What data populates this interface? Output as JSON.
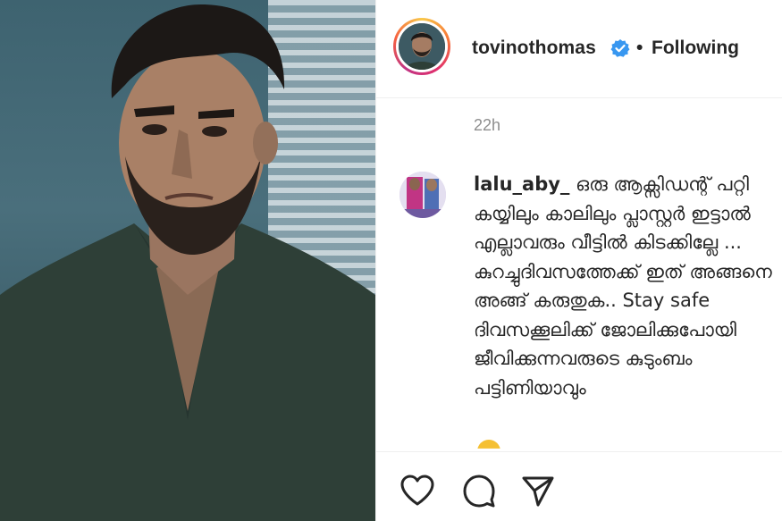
{
  "post": {
    "username": "tovinothomas",
    "separator": "•",
    "follow_status": "Following",
    "verified": true,
    "accent_color": "#3897f0"
  },
  "comment": {
    "timestamp": "22h",
    "author": "lalu_aby_",
    "text": "ഒരു ആക്സിഡന്റ് പറ്റി കയ്യിലും കാലിലും പ്ലാസ്റ്റർ ഇട്ടാൽ എല്ലാവരും വീട്ടിൽ കിടക്കില്ലേ ... കുറച്ചുദിവസത്തേക്ക് ഇത് അങ്ങനെ അങ്ങ് കരുതുക.. Stay safe ദിവസക്കൂലിക്ക് ജോലിക്കുപോയി ജീവിക്കുന്നവരുടെ കുടുംബം പട്ടിണിയാവും"
  },
  "actions": {
    "like_icon": "heart-icon",
    "comment_icon": "comment-icon",
    "share_icon": "send-icon"
  }
}
